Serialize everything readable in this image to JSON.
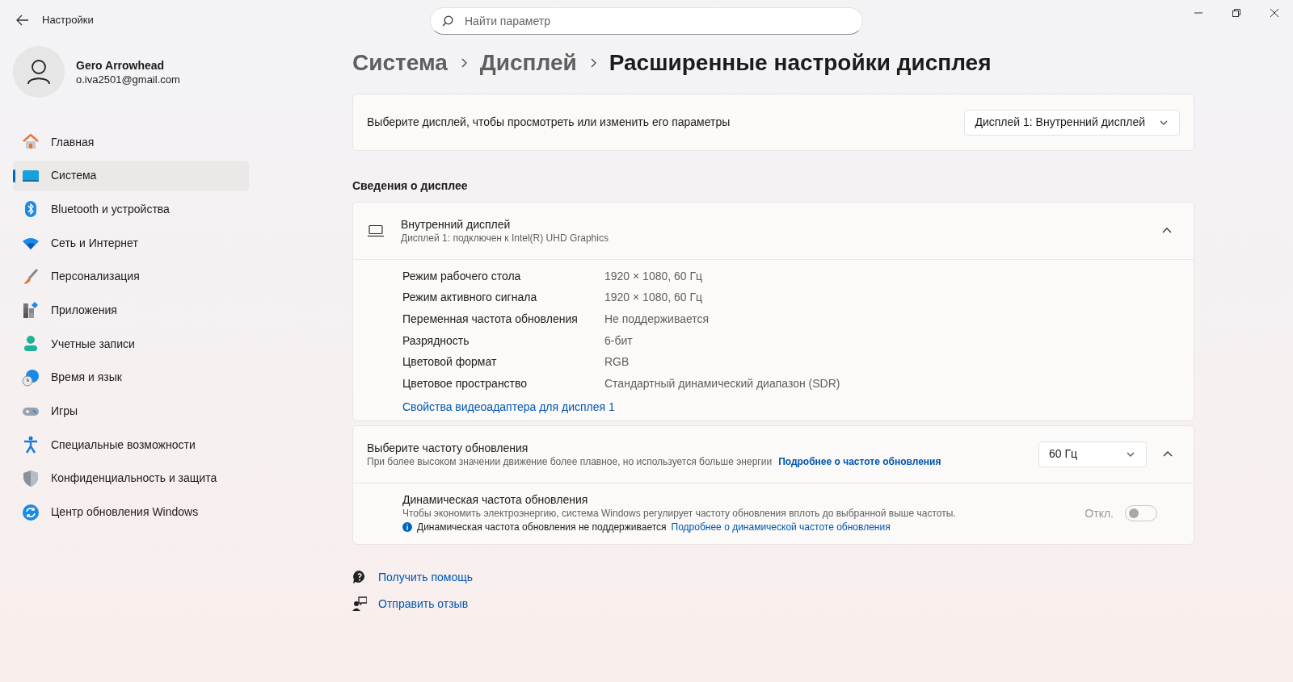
{
  "window": {
    "title": "Настройки"
  },
  "search": {
    "placeholder": "Найти параметр"
  },
  "profile": {
    "name": "Gero Arrowhead",
    "email": "o.iva2501@gmail.com"
  },
  "sidebar": {
    "items": [
      {
        "label": "Главная",
        "selected": false
      },
      {
        "label": "Система",
        "selected": true
      },
      {
        "label": "Bluetooth и устройства",
        "selected": false
      },
      {
        "label": "Сеть и Интернет",
        "selected": false
      },
      {
        "label": "Персонализация",
        "selected": false
      },
      {
        "label": "Приложения",
        "selected": false
      },
      {
        "label": "Учетные записи",
        "selected": false
      },
      {
        "label": "Время и язык",
        "selected": false
      },
      {
        "label": "Игры",
        "selected": false
      },
      {
        "label": "Специальные возможности",
        "selected": false
      },
      {
        "label": "Конфиденциальность и защита",
        "selected": false
      },
      {
        "label": "Центр обновления Windows",
        "selected": false
      }
    ]
  },
  "breadcrumb": [
    "Система",
    "Дисплей",
    "Расширенные настройки дисплея"
  ],
  "display_select": {
    "label": "Выберите дисплей, чтобы просмотреть или изменить его параметры",
    "value": "Дисплей 1: Внутренний дисплей"
  },
  "section_title": "Сведения о дисплее",
  "display_info": {
    "title": "Внутренний дисплей",
    "subtitle": "Дисплей 1: подключен к Intel(R) UHD Graphics",
    "expanded": true,
    "rows": [
      {
        "label": "Режим рабочего стола",
        "value": "1920 × 1080, 60 Гц"
      },
      {
        "label": "Режим активного сигнала",
        "value": "1920 × 1080, 60 Гц"
      },
      {
        "label": "Переменная частота обновления",
        "value": "Не поддерживается"
      },
      {
        "label": "Разрядность",
        "value": "6-бит"
      },
      {
        "label": "Цветовой формат",
        "value": "RGB"
      },
      {
        "label": "Цветовое пространство",
        "value": "Стандартный динамический диапазон (SDR)"
      }
    ],
    "link": "Свойства видеоадаптера для дисплея 1"
  },
  "refresh_rate": {
    "title": "Выберите частоту обновления",
    "description": "При более высоком значении движение более плавное, но используется больше энергии",
    "link": "Подробнее о частоте обновления",
    "value": "60 Гц",
    "expanded": true,
    "dynamic": {
      "title": "Динамическая частота обновления",
      "description": "Чтобы экономить электроэнергию, система Windows регулирует частоту обновления вплоть до выбранной выше частоты.",
      "notice": "Динамическая частота обновления не поддерживается",
      "link": "Подробнее о динамической частоте обновления",
      "state_label": "Откл.",
      "on": false,
      "disabled": true
    }
  },
  "help_links": [
    "Получить помощь",
    "Отправить отзыв"
  ]
}
